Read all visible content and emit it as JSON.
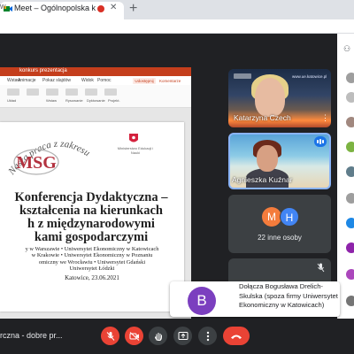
{
  "browser": {
    "tab_title": "Meet – Ogólnopolska konf",
    "tab_close": "✕",
    "new_tab": "+",
    "address_fragment": "w"
  },
  "presentation": {
    "filename": "konkurs prezentacja",
    "ribbon_tabs": [
      "Wstaw",
      "Animacje",
      "Pokaz slajdów",
      "Widok",
      "Pomoc",
      "Rysuj",
      "Przejścia",
      "Recenzja",
      "Pomoc"
    ],
    "ribbon_labels": [
      "Układ",
      "Wstaw",
      "Rysowanie",
      "Dyktowanie",
      "Projekt."
    ],
    "share_label": "Udostępnij",
    "comments_label": "Komentarze",
    "slide": {
      "logo_arc_text": "Nasza praca z zakresu",
      "logo_text": "MSG",
      "ministry_text": "Ministerstwo Edukacji i Nauki",
      "title_lines": [
        "Konferencja Dydaktyczna –",
        "kształcenia na kierunkach",
        "h z międzynarodowymi",
        "kami gospodarczymi"
      ],
      "universities": [
        "y w Warszawie • Uniwersytet Ekonomiczny w Katowicach",
        "w Krakowie • Uniwersytet Ekonomiczny w Poznaniu",
        "omiczny we Wrocławiu • Uniwersytet Gdański",
        "Uniwersytet Łódzki"
      ],
      "date_line": "Katowice, 23.06.2021"
    }
  },
  "tiles": {
    "participant_1": {
      "name": "Katarzyna Czech",
      "url": "www.ue.katowice.pl"
    },
    "participant_2": {
      "name": "Agnieszka Kuźnar"
    },
    "others": {
      "avatar_1": "M",
      "avatar_2": "H",
      "label": "22 inne osoby"
    }
  },
  "notification": {
    "avatar_letter": "B",
    "text": "Dołącza Bogusława Drelich-Skulska (spoza firmy Uniwersytet Ekonomiczny w Katowicach)"
  },
  "controls": {
    "meeting_title": "rczna - dobre pr..."
  },
  "colors": {
    "meet_bg": "#202124",
    "ppt_brand": "#c43e1c",
    "hangup_red": "#ea4335",
    "speaking_blue": "#1a73e8",
    "toast_avatar": "#7b3fbf"
  }
}
